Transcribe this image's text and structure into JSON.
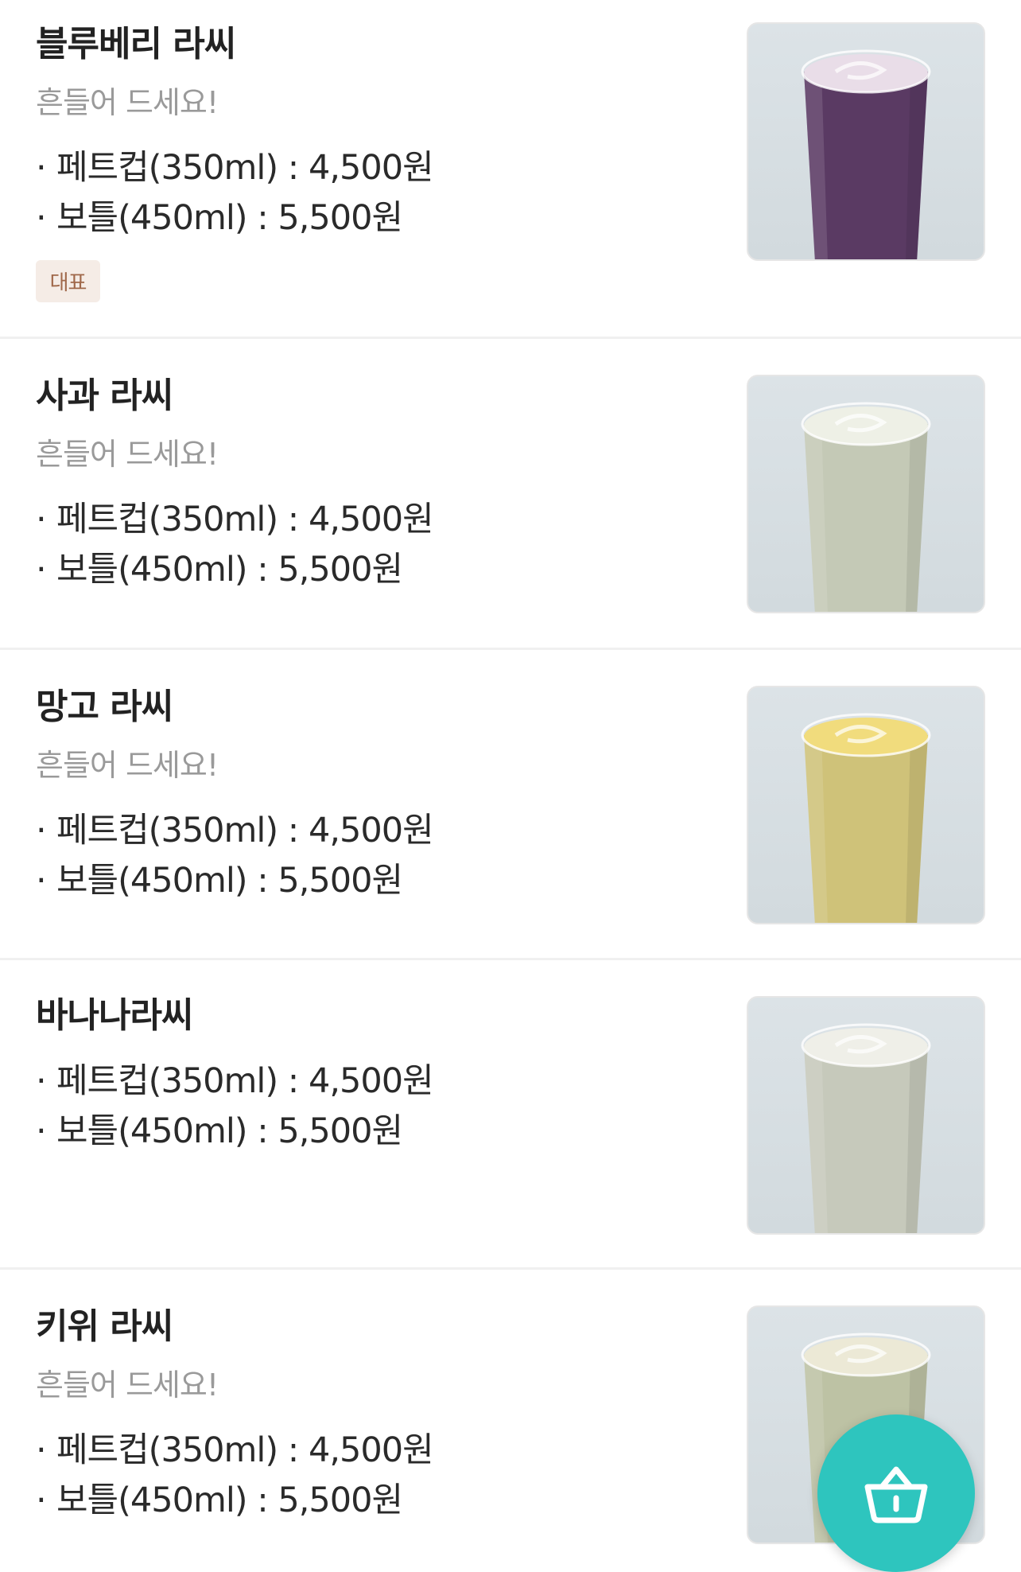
{
  "items": [
    {
      "name": "블루베리 라씨",
      "desc": "흔들어 드세요!",
      "price1": "페트컵(350ml) : 4,500원",
      "price2": "보틀(450ml) : 5,500원",
      "badge": "대표",
      "drink_color": "#5a3a63",
      "foam_color": "#e9dde8"
    },
    {
      "name": "사과 라씨",
      "desc": "흔들어 드세요!",
      "price1": "페트컵(350ml) : 4,500원",
      "price2": "보틀(450ml) : 5,500원",
      "drink_color": "#c4c9b6",
      "foam_color": "#eef0e6"
    },
    {
      "name": "망고 라씨",
      "desc": "흔들어 드세요!",
      "price1": "페트컵(350ml) : 4,500원",
      "price2": "보틀(450ml) : 5,500원",
      "drink_color": "#cfc279",
      "foam_color": "#f1dc7d"
    },
    {
      "name": "바나나라씨",
      "price1": "페트컵(350ml) : 4,500원",
      "price2": "보틀(450ml) : 5,500원",
      "drink_color": "#c6c9bb",
      "foam_color": "#efefe8"
    },
    {
      "name": "키위 라씨",
      "desc": "흔들어 드세요!",
      "price1": "페트컵(350ml) : 4,500원",
      "price2": "보틀(450ml) : 5,500원",
      "drink_color": "#bdc2a4",
      "foam_color": "#ece9d6"
    }
  ],
  "bullet": "·",
  "cart": {
    "icon": "basket-icon",
    "color": "#2ec5be"
  }
}
